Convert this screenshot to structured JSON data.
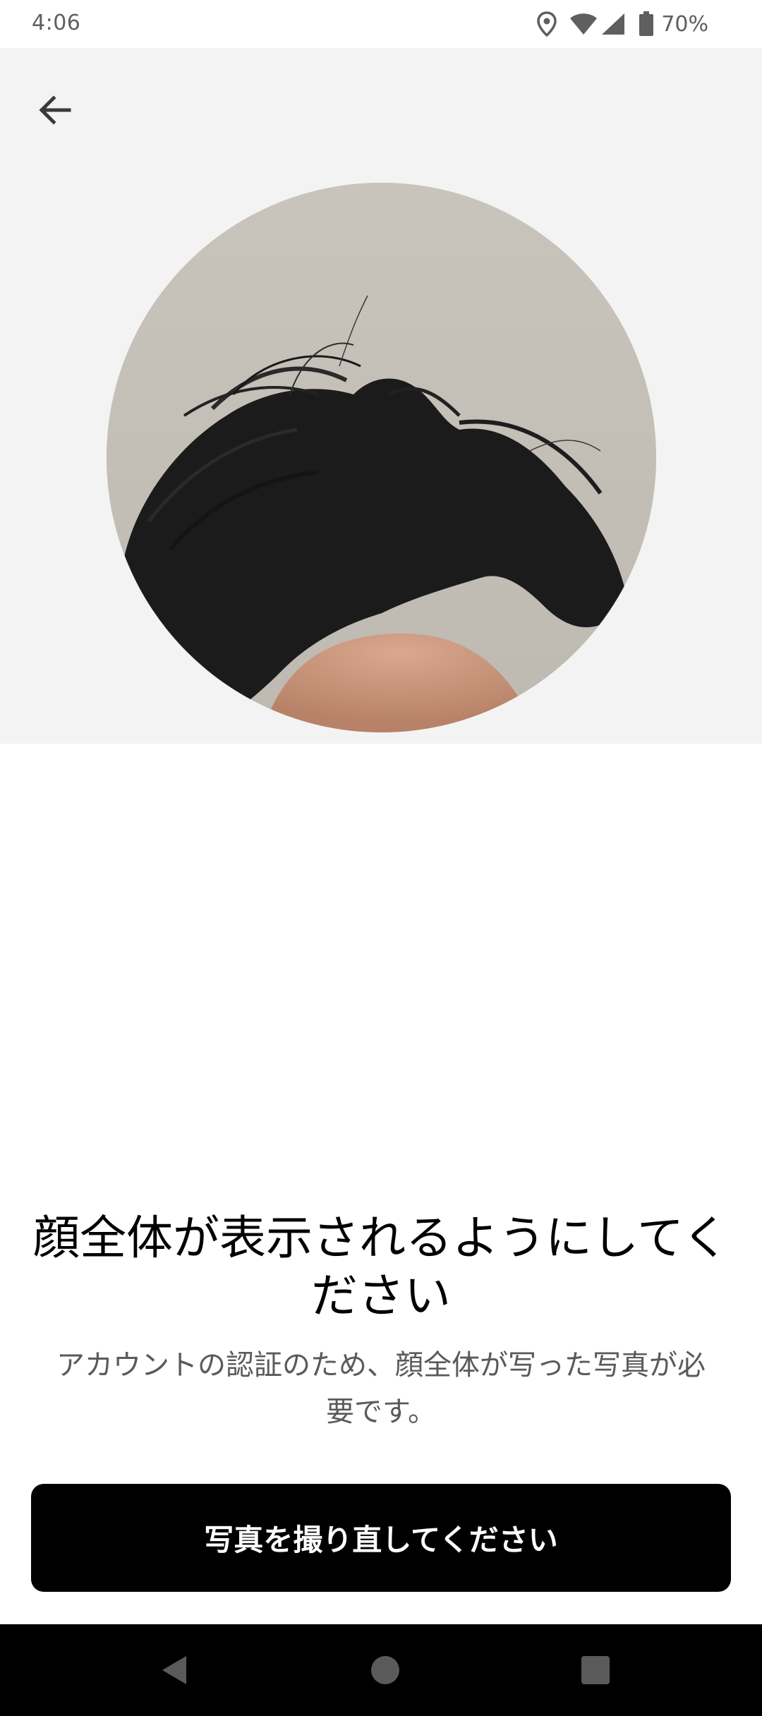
{
  "status_bar": {
    "time": "4:06",
    "battery_percent": "70%",
    "icons": [
      "location-icon",
      "wifi-icon",
      "cell-signal-icon",
      "battery-icon"
    ]
  },
  "header": {
    "back_icon": "arrow-left-icon"
  },
  "photo": {
    "description_icon": "captured-face-photo"
  },
  "content": {
    "title": "顔全体が表示されるようにしてください",
    "subtitle": "アカウントの認証のため、顔全体が写った写真が必要です。"
  },
  "actions": {
    "retake_label": "写真を撮り直してください"
  },
  "nav_bar": {
    "icons": [
      "back-triangle-icon",
      "home-circle-icon",
      "recents-square-icon"
    ]
  },
  "colors": {
    "hero_background": "#f3f3f3",
    "button_background": "#000000",
    "button_text": "#ffffff",
    "subtitle_text": "#5a5a5a"
  }
}
